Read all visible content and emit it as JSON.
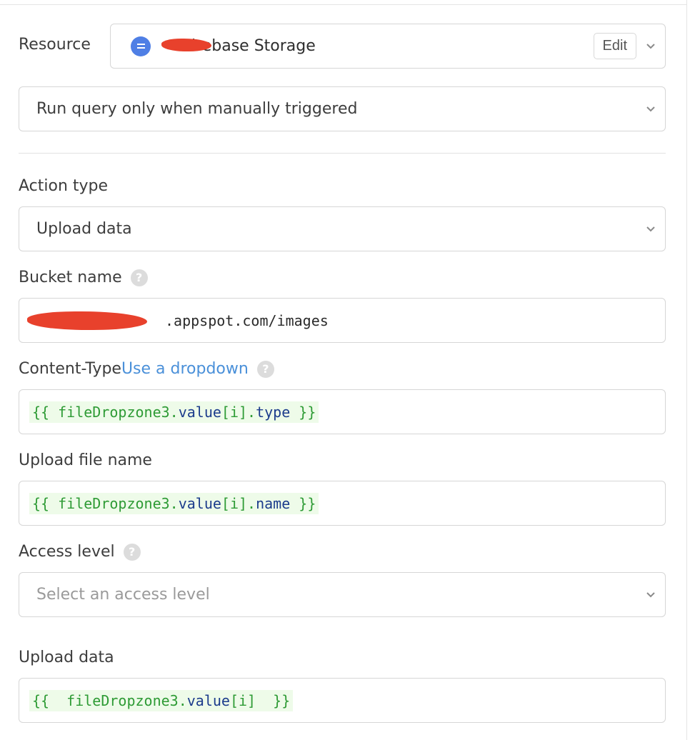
{
  "resource": {
    "label": "Resource",
    "name": "Firebase Storage",
    "edit_label": "Edit"
  },
  "trigger": {
    "value": "Run query only when manually triggered"
  },
  "action_type": {
    "label": "Action type",
    "value": "Upload data"
  },
  "bucket_name": {
    "label": "Bucket name",
    "value": ".appspot.com/images"
  },
  "content_type": {
    "label": "Content-Type",
    "link": "Use a dropdown",
    "code_open": "{{ ",
    "code_obj": "fileDropzone3.",
    "code_prop": "value",
    "code_rest": "[i].",
    "code_field": "type",
    "code_close": " }}"
  },
  "upload_file_name": {
    "label": "Upload file name",
    "code_open": "{{ ",
    "code_obj": "fileDropzone3.",
    "code_prop": "value",
    "code_rest": "[i].",
    "code_field": "name",
    "code_close": " }}"
  },
  "access_level": {
    "label": "Access level",
    "placeholder": "Select an access level"
  },
  "upload_data": {
    "label": "Upload data",
    "code_open": "{{  ",
    "code_obj": "fileDropzone3.",
    "code_prop": "value",
    "code_rest": "[i]",
    "code_close": "  }}"
  },
  "icons": {
    "help": "?",
    "chevron": "chevron-down-icon",
    "resource": "database-icon"
  },
  "colors": {
    "accent_link": "#4a90d9",
    "code_green": "#2e9b35",
    "code_blue": "#1c3c8c",
    "resource_icon": "#4f7fe5",
    "redaction": "#e8412c"
  }
}
